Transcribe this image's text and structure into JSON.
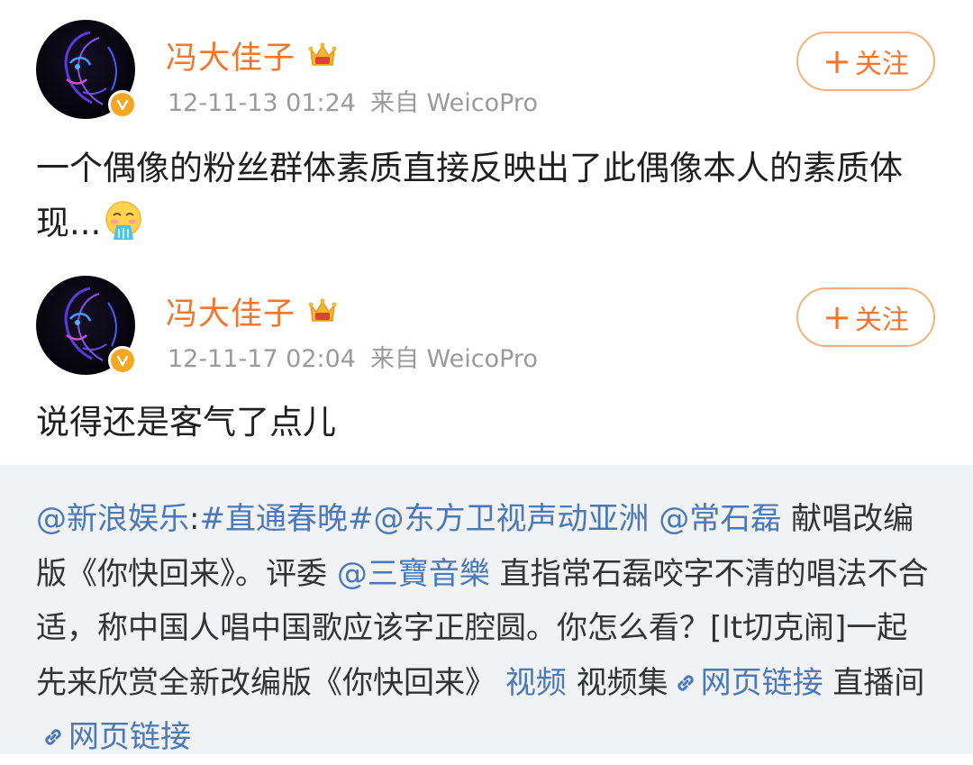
{
  "posts": [
    {
      "username": "冯大佳子",
      "time": "12-11-13 01:24",
      "source": "来自 WeicoPro",
      "follow_label": "关注",
      "content": "一个偶像的粉丝群体素质直接反映出了此偶像本人的素质体现...",
      "emoji": "vomit-emoji"
    },
    {
      "username": "冯大佳子",
      "time": "12-11-17 02:04",
      "source": "来自 WeicoPro",
      "follow_label": "关注",
      "content": "说得还是客气了点儿"
    }
  ],
  "repost": {
    "segments": {
      "m1": "@新浪娱乐",
      "t1": ":",
      "h1": "#直通春晚#",
      "m2": "@东方卫视声动亚洲",
      "m3": "@常石磊",
      "t2": " 献唱改编版《你快回来》。评委 ",
      "m4": "@三寶音樂",
      "t3": " 直指常石磊咬字不清的唱法不合适，称中国人唱中国歌应该字正腔圆。你怎么看？[lt切克闹]一起先来欣赏全新改编版《你快回来》 ",
      "l1": "视频",
      "t4": " 视频集",
      "l2": "网页链接",
      "t5": " 直播间",
      "l3": "网页链接"
    }
  },
  "colors": {
    "username": "#f2762f",
    "link": "#4a78b8",
    "meta": "#9a9a9a",
    "verified_badge": "#f5a623",
    "repost_bg": "#f1f2f3"
  },
  "icons": [
    "crown-icon",
    "verified-badge-icon",
    "link-icon",
    "plus-icon"
  ]
}
